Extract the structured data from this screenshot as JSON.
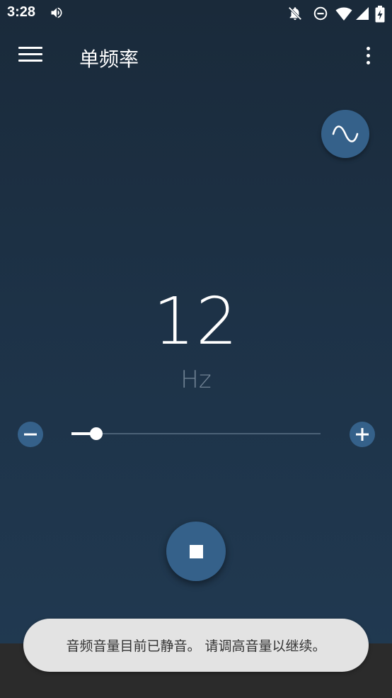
{
  "status_bar": {
    "time": "3:28",
    "icons": [
      "volume-icon",
      "notifications-off-icon",
      "do-not-disturb-icon",
      "wifi-icon",
      "signal-icon",
      "battery-charging-icon"
    ]
  },
  "app_bar": {
    "title": "单频率",
    "menu_icon": "hamburger-menu-icon",
    "more_icon": "more-vert-icon"
  },
  "waveform_button": {
    "icon": "sine-wave-icon"
  },
  "frequency": {
    "value": "12",
    "unit": "Hz"
  },
  "slider": {
    "level": 0.1,
    "minus_icon": "minus-icon",
    "plus_icon": "plus-icon"
  },
  "playback": {
    "state_icon": "stop-icon"
  },
  "toast": {
    "message": "音频音量目前已静音。 请调高音量以继续。"
  },
  "colors": {
    "background_top": "#1a2a3a",
    "background_bottom": "#213a52",
    "accent_button": "#35618a",
    "unit_text": "#6f8193",
    "toast_bg": "#e3e3e3",
    "toast_text": "#333333"
  }
}
